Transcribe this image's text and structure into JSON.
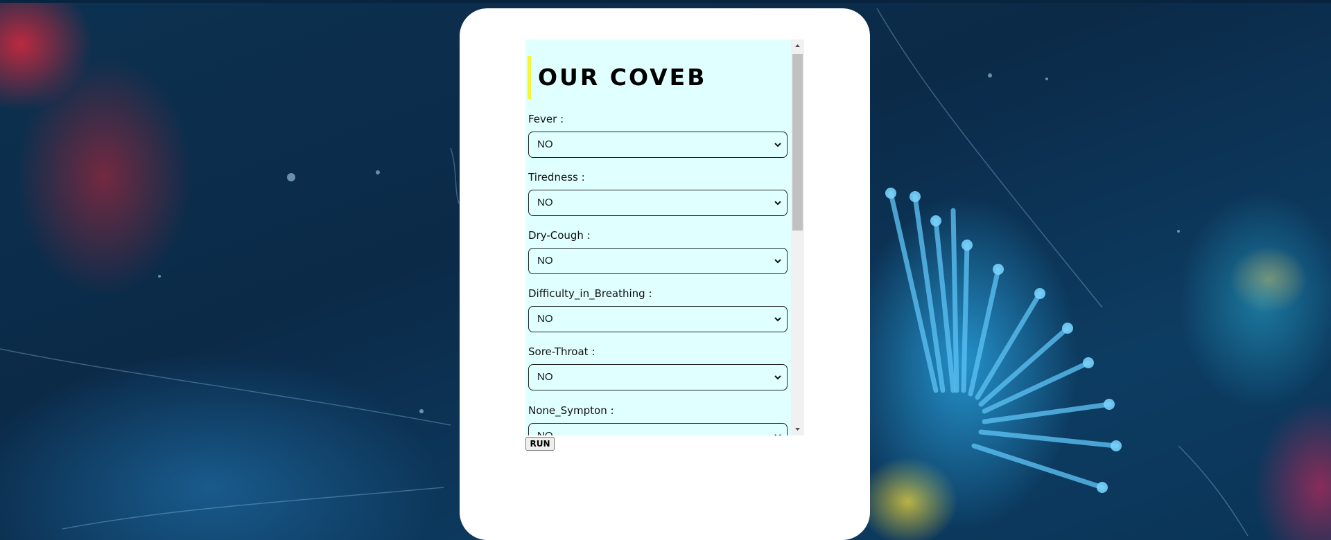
{
  "form": {
    "title": "OUR COVEB",
    "fields": [
      {
        "label": "Fever :",
        "value": "NO"
      },
      {
        "label": "Tiredness :",
        "value": "NO"
      },
      {
        "label": "Dry-Cough :",
        "value": "NO"
      },
      {
        "label": "Difficulty_in_Breathing :",
        "value": "NO"
      },
      {
        "label": "Sore-Throat :",
        "value": "NO"
      },
      {
        "label": "None_Sympton :",
        "value": "NO"
      }
    ],
    "run_label": "RUN"
  },
  "colors": {
    "panel_bg": "#e0ffff",
    "title_accent": "#f5f53a",
    "card_bg": "#ffffff"
  },
  "icons": {
    "select_arrow": "chevron-down-icon",
    "scroll_up": "scroll-up-arrow-icon",
    "scroll_down": "scroll-down-arrow-icon"
  }
}
